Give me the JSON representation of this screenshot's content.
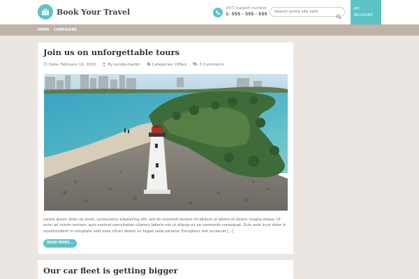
{
  "header": {
    "logo_text": "Book Your Travel",
    "support_label": "24/7 Support number",
    "support_phone": "1- 555 - 555 - 555",
    "search_placeholder": "Search entire site here",
    "account_line1": "MY",
    "account_line2": "ACCOUNT"
  },
  "nav": {
    "items": [
      {
        "label": "HOME"
      },
      {
        "label": "CONFIGURE"
      }
    ]
  },
  "posts": [
    {
      "title": "Join us on unforgettable tours",
      "date": "Date: February 19, 2015",
      "author": "By sunilkumarbh",
      "categories": "Categories: Offers",
      "comments": "3 Comments",
      "excerpt": "Lorem ipsum dolor sit amet, consectetur adipisicing elit, sed do eiusmod tempor incididunt ut labore et dolore magna aliqua. Ut enim ad minim veniam, quis nostrud exercitation ullamco laboris nisi ut aliquip ex ea commodo consequat. Duis aute irure dolor in reprehenderit in voluptate velit esse cillum dolore eu fugiat nulla pariatur. Excepteur sint occaecat [...]",
      "read_more": "READ MORE..."
    },
    {
      "title": "Our car fleet is getting bigger"
    }
  ],
  "colors": {
    "accent": "#5cc3c4",
    "nav_bg": "#bfb3a8",
    "page_bg": "#ebe6e1"
  },
  "icons": {
    "logo": "suitcase-icon",
    "phone": "phone-icon",
    "search": "search-icon",
    "date": "clock-icon",
    "author": "user-icon",
    "categories": "tag-icon",
    "comments": "comments-icon"
  }
}
